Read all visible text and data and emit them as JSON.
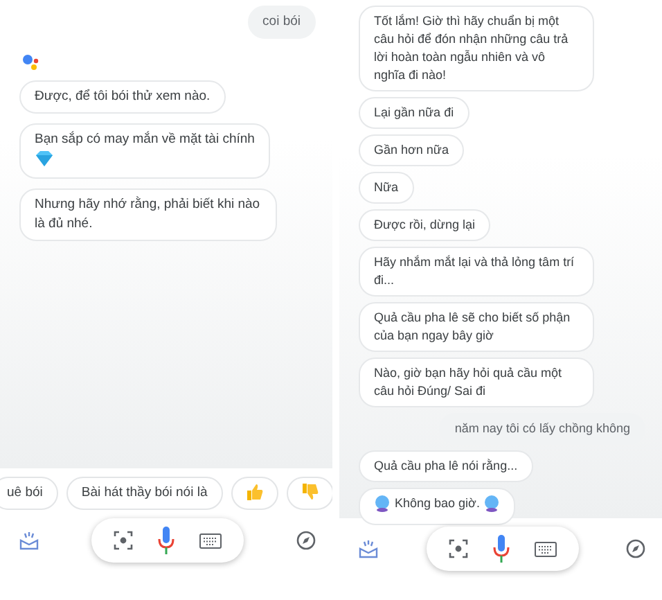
{
  "screens": [
    {
      "assistant_logo": true,
      "messages": [
        {
          "from_user": true,
          "kind": "plain",
          "text": "coi bói"
        },
        {
          "from_user": false,
          "kind": "plain",
          "text": "Được, để tôi bói thử xem nào."
        },
        {
          "from_user": false,
          "kind": "gem",
          "text": "Bạn sắp có may mắn về mặt tài chính"
        },
        {
          "from_user": false,
          "kind": "plain",
          "text": "Nhưng hãy nhớ rằng, phải biết khi nào là đủ nhé."
        }
      ],
      "suggestions": [
        {
          "kind": "text",
          "label": "uê bói"
        },
        {
          "kind": "text",
          "label": "Bài hát thầy bói nói là"
        },
        {
          "kind": "thumb_up"
        },
        {
          "kind": "thumb_down"
        }
      ]
    },
    {
      "messages": [
        {
          "from_user": false,
          "kind": "plain",
          "text": "Tốt lắm! Giờ thì hãy chuẩn bị một câu hỏi để đón nhận những câu trả lời hoàn toàn ngẫu nhiên và vô nghĩa đi nào!"
        },
        {
          "from_user": false,
          "kind": "plain",
          "text": "Lại gần nữa đi"
        },
        {
          "from_user": false,
          "kind": "plain",
          "text": "Gần hơn nữa"
        },
        {
          "from_user": false,
          "kind": "plain",
          "text": "Nữa"
        },
        {
          "from_user": false,
          "kind": "plain",
          "text": "Được rồi, dừng lại"
        },
        {
          "from_user": false,
          "kind": "plain",
          "text": "Hãy nhắm mắt lại và thả lỏng tâm trí đi..."
        },
        {
          "from_user": false,
          "kind": "plain",
          "text": "Quả cầu pha lê sẽ cho biết số phận của bạn ngay bây giờ"
        },
        {
          "from_user": false,
          "kind": "plain",
          "text": "Nào, giờ bạn hãy hỏi quả cầu một câu hỏi Đúng/ Sai đi"
        },
        {
          "from_user": true,
          "kind": "plain",
          "text": "năm nay tôi có lấy chồng không"
        },
        {
          "from_user": false,
          "kind": "plain",
          "text": "Quả cầu pha lê nói rằng..."
        },
        {
          "from_user": false,
          "kind": "orb",
          "text": "Không bao giờ."
        }
      ]
    }
  ]
}
